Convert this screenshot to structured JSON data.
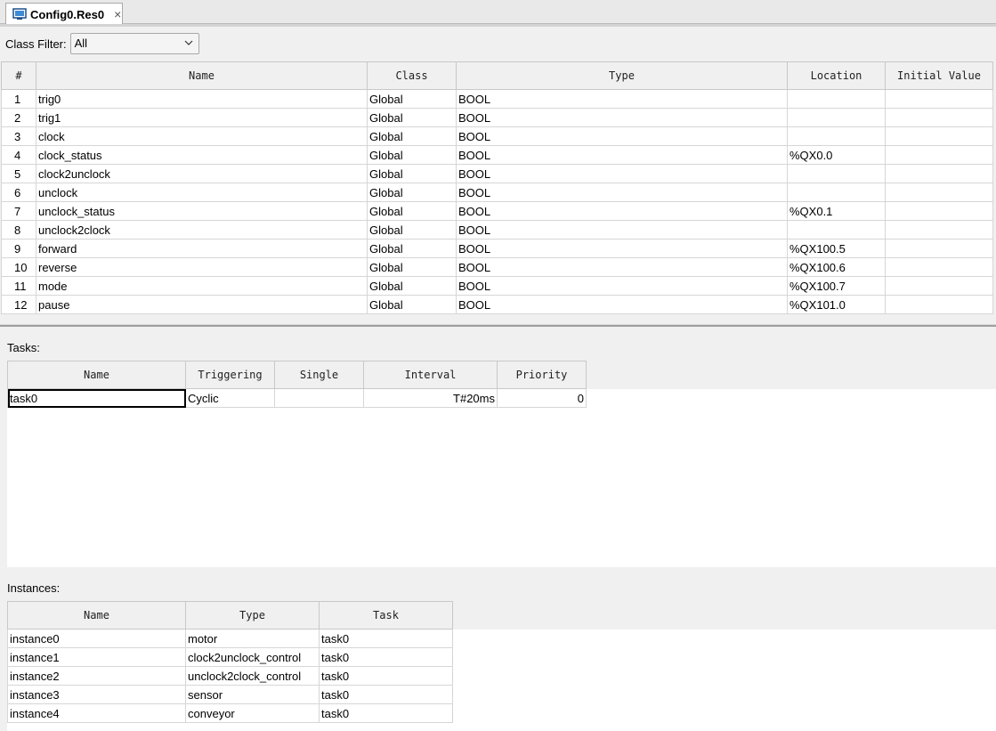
{
  "tab": {
    "title": "Config0.Res0",
    "icon": "resource-config-icon",
    "close": "×"
  },
  "class_filter": {
    "label": "Class Filter:",
    "selected": "All"
  },
  "variables": {
    "columns": [
      "#",
      "Name",
      "Class",
      "Type",
      "Location",
      "Initial Value"
    ],
    "rows": [
      [
        "1",
        "trig0",
        "Global",
        "BOOL",
        "",
        ""
      ],
      [
        "2",
        "trig1",
        "Global",
        "BOOL",
        "",
        ""
      ],
      [
        "3",
        "clock",
        "Global",
        "BOOL",
        "",
        ""
      ],
      [
        "4",
        "clock_status",
        "Global",
        "BOOL",
        "%QX0.0",
        ""
      ],
      [
        "5",
        "clock2unclock",
        "Global",
        "BOOL",
        "",
        ""
      ],
      [
        "6",
        "unclock",
        "Global",
        "BOOL",
        "",
        ""
      ],
      [
        "7",
        "unclock_status",
        "Global",
        "BOOL",
        "%QX0.1",
        ""
      ],
      [
        "8",
        "unclock2clock",
        "Global",
        "BOOL",
        "",
        ""
      ],
      [
        "9",
        "forward",
        "Global",
        "BOOL",
        "%QX100.5",
        ""
      ],
      [
        "10",
        "reverse",
        "Global",
        "BOOL",
        "%QX100.6",
        ""
      ],
      [
        "11",
        "mode",
        "Global",
        "BOOL",
        "%QX100.7",
        ""
      ],
      [
        "12",
        "pause",
        "Global",
        "BOOL",
        "%QX101.0",
        ""
      ]
    ]
  },
  "tasks": {
    "label": "Tasks:",
    "columns": [
      "Name",
      "Triggering",
      "Single",
      "Interval",
      "Priority"
    ],
    "rows": [
      [
        "task0",
        "Cyclic",
        "",
        "T#20ms",
        "0"
      ]
    ]
  },
  "instances": {
    "label": "Instances:",
    "columns": [
      "Name",
      "Type",
      "Task"
    ],
    "rows": [
      [
        "instance0",
        "motor",
        "task0"
      ],
      [
        "instance1",
        "clock2unclock_control",
        "task0"
      ],
      [
        "instance2",
        "unclock2clock_control",
        "task0"
      ],
      [
        "instance3",
        "sensor",
        "task0"
      ],
      [
        "instance4",
        "conveyor",
        "task0"
      ]
    ]
  }
}
